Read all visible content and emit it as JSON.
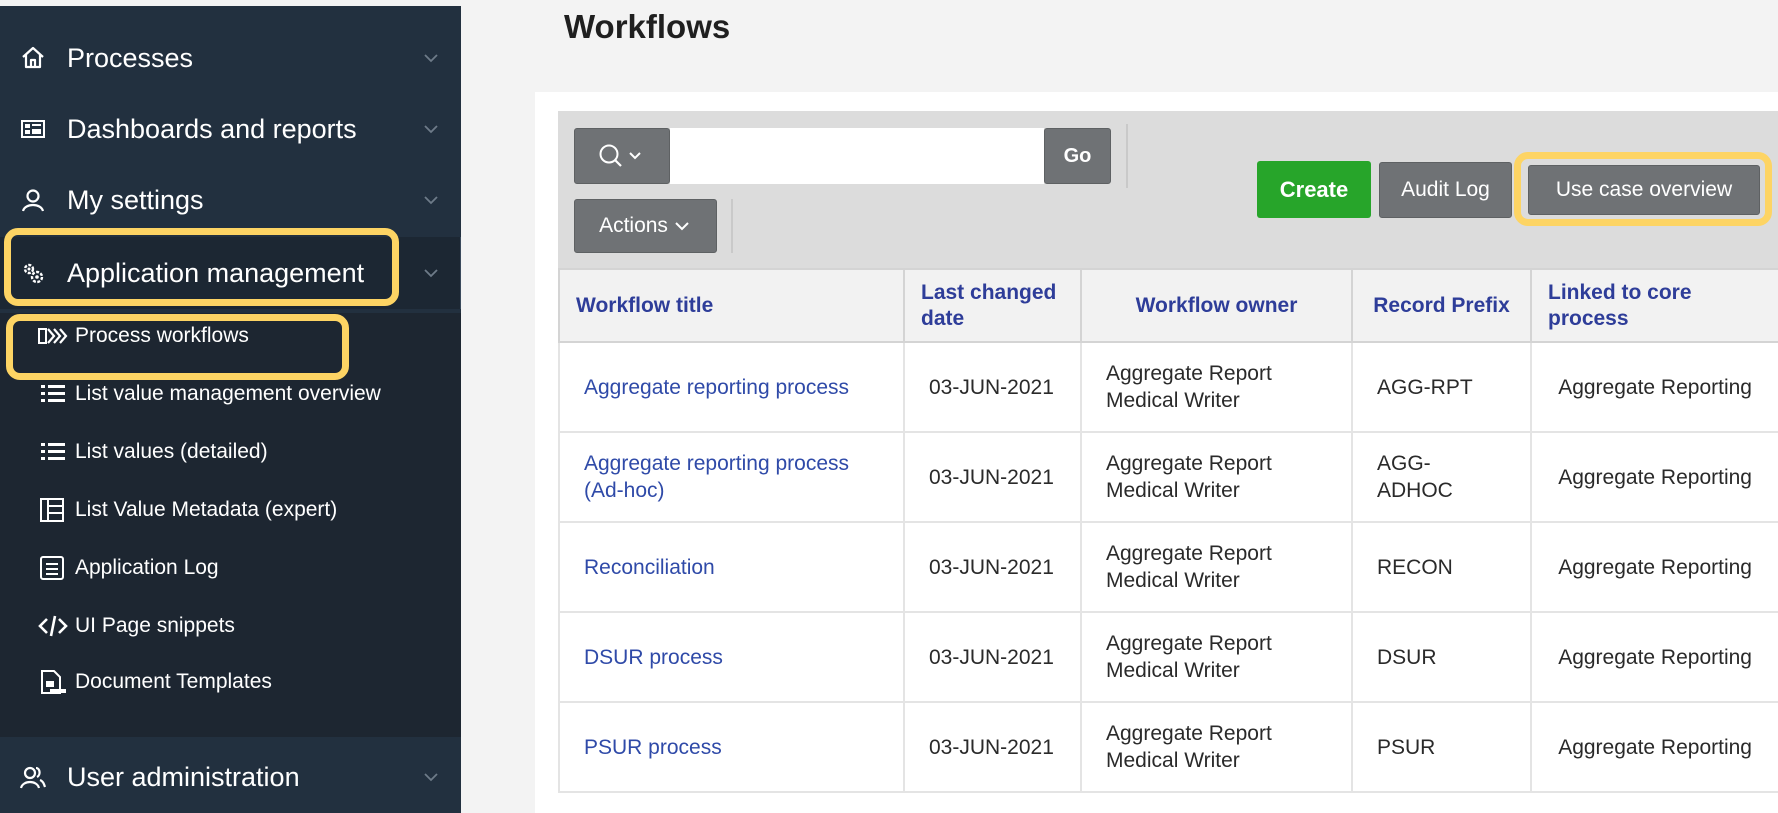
{
  "sidebar": {
    "nav": [
      {
        "label": "Processes",
        "icon": "home-icon"
      },
      {
        "label": "Dashboards and reports",
        "icon": "dashboard-icon"
      },
      {
        "label": "My settings",
        "icon": "user-icon"
      },
      {
        "label": "Application management",
        "icon": "gears-icon"
      },
      {
        "label": "User administration",
        "icon": "users-icon"
      }
    ],
    "sub_items": [
      {
        "label": "Process workflows",
        "icon": "workflow-icon"
      },
      {
        "label": "List value management overview",
        "icon": "list-icon"
      },
      {
        "label": "List values (detailed)",
        "icon": "list-icon"
      },
      {
        "label": "List Value Metadata (expert)",
        "icon": "table-icon"
      },
      {
        "label": "Application Log",
        "icon": "log-icon"
      },
      {
        "label": "UI Page snippets",
        "icon": "code-icon"
      },
      {
        "label": "Document Templates",
        "icon": "document-template-icon"
      }
    ]
  },
  "main": {
    "title": "Workflows",
    "toolbar": {
      "search_placeholder": "",
      "go_label": "Go",
      "actions_label": "Actions",
      "create_label": "Create",
      "audit_label": "Audit Log",
      "use_case_label": "Use case overview"
    },
    "table": {
      "columns": [
        "Workflow title",
        "Last changed date",
        "Workflow owner",
        "Record Prefix",
        "Linked to core process"
      ],
      "rows": [
        {
          "title": "Aggregate reporting process",
          "date": "03-JUN-2021",
          "owner": "Aggregate Report Medical Writer",
          "prefix": "AGG-RPT",
          "linked": "Aggregate Reporting"
        },
        {
          "title": "Aggregate reporting process (Ad-hoc)",
          "date": "03-JUN-2021",
          "owner": "Aggregate Report Medical Writer",
          "prefix": "AGG-ADHOC",
          "linked": "Aggregate Reporting"
        },
        {
          "title": "Reconciliation",
          "date": "03-JUN-2021",
          "owner": "Aggregate Report Medical Writer",
          "prefix": "RECON",
          "linked": "Aggregate Reporting"
        },
        {
          "title": "DSUR process",
          "date": "03-JUN-2021",
          "owner": "Aggregate Report Medical Writer",
          "prefix": "DSUR",
          "linked": "Aggregate Reporting"
        },
        {
          "title": "PSUR process",
          "date": "03-JUN-2021",
          "owner": "Aggregate Report Medical Writer",
          "prefix": "PSUR",
          "linked": "Aggregate Reporting"
        }
      ]
    }
  },
  "colors": {
    "sidebar_bg": "#22303f",
    "highlight": "#fdd464",
    "link": "#2f4aa8",
    "create_green": "#27a52a"
  }
}
